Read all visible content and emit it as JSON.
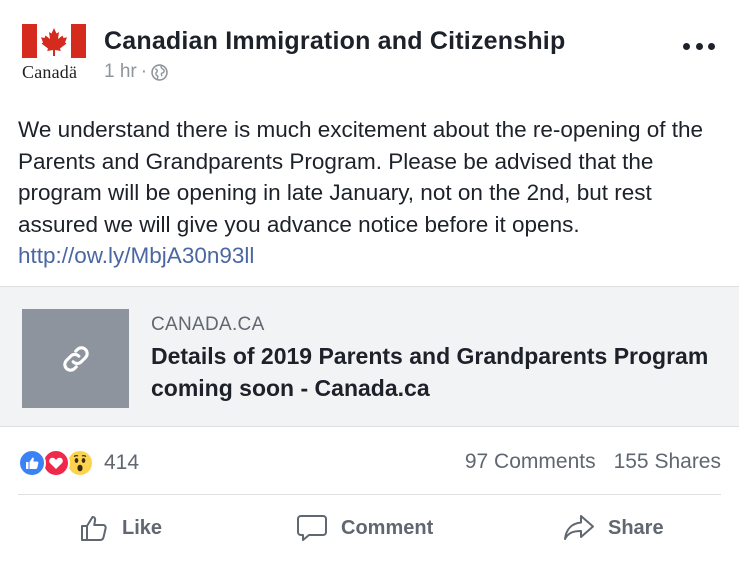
{
  "post": {
    "page_name": "Canadian Immigration and Citizenship",
    "logo_wordmark": "Canadä",
    "timestamp": "1 hr",
    "separator": "·",
    "audience_icon": "globe-icon",
    "more_icon": "more-options-icon",
    "text_before_link": "We understand there is much excitement about the re-opening of the Parents and Grandparents Program. Please be advised that the program will be opening in late January, not on the 2nd, but rest assured we will give you advance notice before it opens. ",
    "link_text": "http://ow.ly/MbjA30n93ll"
  },
  "preview": {
    "domain": "CANADA.CA",
    "title": "Details of 2019 Parents and Grandparents Program coming soon - Canada.ca",
    "thumb_icon": "link-icon"
  },
  "engagement": {
    "reaction_icons": [
      "like-reaction-icon",
      "love-reaction-icon",
      "wow-reaction-icon"
    ],
    "reaction_count": "414",
    "comments": "97 Comments",
    "shares": "155 Shares"
  },
  "actions": {
    "like": "Like",
    "comment": "Comment",
    "share": "Share"
  },
  "colors": {
    "link": "#4b67a1",
    "flag_red": "#d52b1e",
    "like_blue": "#3b82f6",
    "love_red": "#f0284a",
    "wow_yellow": "#fcd34d"
  }
}
